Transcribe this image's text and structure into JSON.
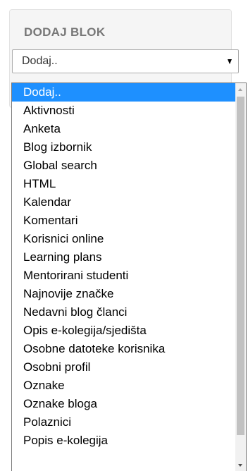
{
  "block": {
    "title": "DODAJ BLOK"
  },
  "select": {
    "current_value": "Dodaj.."
  },
  "dropdown": {
    "options": [
      "Dodaj..",
      "Aktivnosti",
      "Anketa",
      "Blog izbornik",
      "Global search",
      "HTML",
      "Kalendar",
      "Komentari",
      "Korisnici online",
      "Learning plans",
      "Mentorirani studenti",
      "Najnovije značke",
      "Nedavni blog članci",
      "Opis e-kolegija/sjedišta",
      "Osobne datoteke korisnika",
      "Osobni profil",
      "Oznake",
      "Oznake bloga",
      "Polaznici",
      "Popis e-kolegija"
    ],
    "selected_option": "Dodaj.."
  },
  "icons": {
    "select_arrow": "chevron-down-icon",
    "scroll_up": "arrow-up-icon",
    "scroll_down": "arrow-down-icon"
  },
  "colors": {
    "selected_background": "#1e90ff",
    "card_background": "#f5f5f5",
    "title_color": "#777777"
  }
}
